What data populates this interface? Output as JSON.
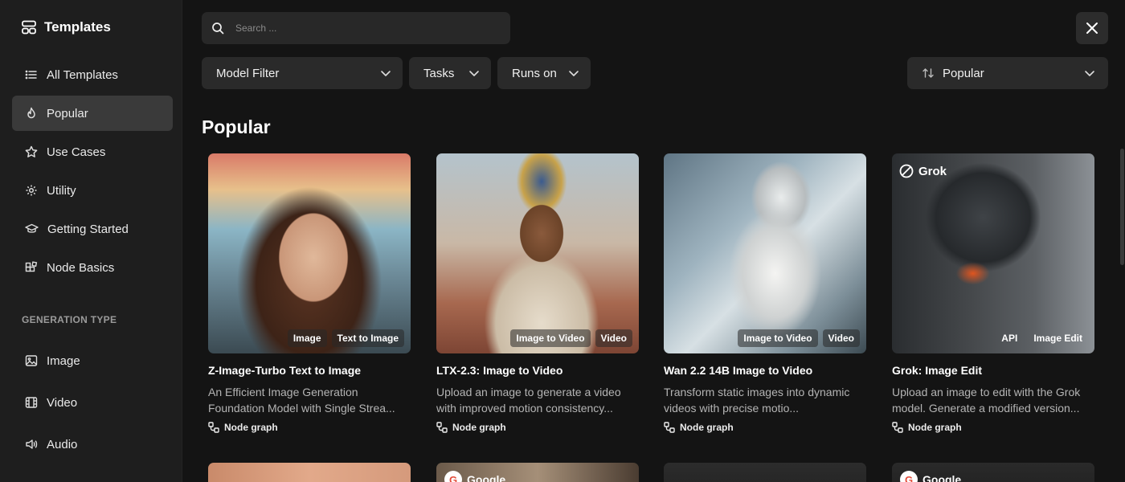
{
  "sidebar": {
    "title": "Templates",
    "items": [
      {
        "label": "All Templates",
        "icon": "list-icon"
      },
      {
        "label": "Popular",
        "icon": "flame-icon"
      },
      {
        "label": "Use Cases",
        "icon": "star-icon"
      },
      {
        "label": "Utility",
        "icon": "gear-icon"
      },
      {
        "label": "Getting Started",
        "icon": "graduation-cap-icon"
      },
      {
        "label": "Node Basics",
        "icon": "blocks-icon"
      }
    ],
    "section_label": "GENERATION TYPE",
    "gen_items": [
      {
        "label": "Image",
        "icon": "image-icon"
      },
      {
        "label": "Video",
        "icon": "film-icon"
      },
      {
        "label": "Audio",
        "icon": "speaker-icon"
      }
    ]
  },
  "search": {
    "placeholder": "Search ..."
  },
  "filters": {
    "model": "Model Filter",
    "tasks": "Tasks",
    "runs_on": "Runs on",
    "sort": "Popular"
  },
  "heading": "Popular",
  "cards": [
    {
      "title": "Z-Image-Turbo Text to Image",
      "desc": "An Efficient Image Generation Foundation Model with Single Strea...",
      "meta": "Node graph",
      "tags": [
        "Image",
        "Text to Image"
      ]
    },
    {
      "title": "LTX-2.3: Image to Video",
      "desc": "Upload an image to generate a video with improved motion consistency...",
      "meta": "Node graph",
      "tags": [
        "Image to Video",
        "Video"
      ]
    },
    {
      "title": "Wan 2.2 14B Image to Video",
      "desc": "Transform static images into dynamic videos with precise motio...",
      "meta": "Node graph",
      "tags": [
        "Image to Video",
        "Video"
      ]
    },
    {
      "title": "Grok: Image Edit",
      "desc": "Upload an image to edit with the Grok model. Generate a modified version...",
      "meta": "Node graph",
      "tags": [
        "API",
        "Image Edit"
      ],
      "brand": "Grok"
    }
  ],
  "row2_badges": [
    "Google",
    "Google"
  ],
  "colors": {
    "background": "#141414",
    "sidebar": "#1e1e1e",
    "control": "#2a2a2a",
    "active": "#3a3a3a"
  }
}
